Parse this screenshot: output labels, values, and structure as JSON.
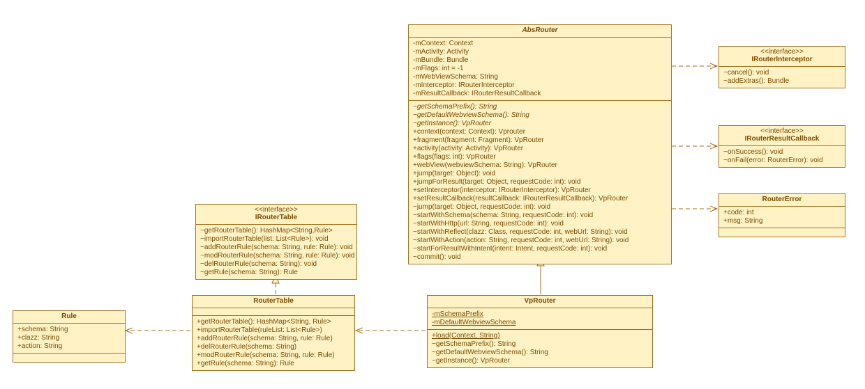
{
  "stereotype_interface": "<<interface>>",
  "rule": {
    "name": "Rule",
    "attrs": [
      "+schema: String",
      "+clazz: String",
      "+action: String"
    ]
  },
  "irouter_table": {
    "name": "IRouterTable",
    "ops": [
      "~getRouterTable(): HashMap<String,Rule>",
      "~importRouterTable(list: List<Rule>): void",
      "~addRouterRule(schema: String, rule: Rule): void",
      "~modRouterRule(schema: String, rule: Rule): void",
      "~delRouterRule(schema: String): void",
      "~getRule(schema: String): Rule"
    ]
  },
  "router_table": {
    "name": "RouterTable",
    "ops": [
      "+getRouterTable(): HashMap<String, Rule>",
      "+importRouterTable(ruleList: List<Rule>)",
      "+addRouterRule(schema: String, rule: Rule)",
      "+delRouterRule(schema: String)",
      "+modRouterRule(schema: String, rule: Rule)",
      "+getRule(schema: String): Rule"
    ]
  },
  "abs_router": {
    "name": "AbsRouter",
    "attrs": [
      "-mContext: Context",
      "-mActivity: Activity",
      "-mBundle: Bundle",
      "-mFlags: int = -1",
      "-mWebViewSchema: String",
      "-mInterceptor: IRouterInterceptor",
      "-mResultCallback: IRouterResultCallback"
    ],
    "ops": [
      "~getSchemaPrefix(): String",
      "~getDefaultWebviewSchema(): String",
      "~getInstance(): VpRouter",
      "+context(context: Context): Vprouter",
      "+fragment(fragment: Fragment): VpRouter",
      "+activity(activity: Activity): VpRouter",
      "+flags(flags: int): VpRouter",
      "+webView(webviewSchema: String): VpRouter",
      "+jump(target: Object): void",
      "+jumpForResult(target: Object, requestCode: int): void",
      "+setInterceptor(interceptor: IRouterInterceptor): VpRouter",
      "+setResultCallback(resultCallback: IRouterResultCallback): VpRouter",
      "~jump(target: Object, requestCode: int): void",
      "~startWithSchema(schema: String, requestCode: int): void",
      "~startWithHttp(url: String, requestCode: int): void",
      "~startWithReflect(clazz: Class, requestCode: int, webUrl: String): void",
      "~startWithAction(action: String, requestCode: int, webUrl: String): void",
      "~startForResultWithIntent(intent: Intent, requestCode: int): void",
      "~commit(): void"
    ]
  },
  "vp_router": {
    "name": "VpRouter",
    "attrs": [
      "-mSchemaPrefix",
      "-mDefaultWebviewSchema"
    ],
    "ops": [
      "+load(Context, String)",
      "~getSchemaPrefix(): String",
      "~getDefaultWebviewSchema(): String",
      "~getInstance(): VpRouter"
    ]
  },
  "irouter_interceptor": {
    "name": "IRouterInterceptor",
    "ops": [
      "~cancel(): void",
      "~addExtras(): Bundle"
    ]
  },
  "irouter_result_callback": {
    "name": "IRouterResultCallback",
    "ops": [
      "~onSuccess(): void",
      "~onFail(error: RouterError): void"
    ]
  },
  "router_error": {
    "name": "RouterError",
    "attrs": [
      "+code: int",
      "+msg: String"
    ]
  },
  "chart_data": {
    "type": "uml_class_diagram",
    "classes": [
      {
        "name": "Rule",
        "attributes": [
          "schema: String",
          "clazz: String",
          "action: String"
        ],
        "operations": []
      },
      {
        "name": "IRouterTable",
        "stereotype": "interface",
        "attributes": [],
        "operations": [
          "getRouterTable(): HashMap<String,Rule>",
          "importRouterTable(list: List<Rule>): void",
          "addRouterRule(schema: String, rule: Rule): void",
          "modRouterRule(schema: String, rule: Rule): void",
          "delRouterRule(schema: String): void",
          "getRule(schema: String): Rule"
        ]
      },
      {
        "name": "RouterTable",
        "attributes": [],
        "operations": [
          "getRouterTable(): HashMap<String,Rule>",
          "importRouterTable(ruleList: List<Rule>)",
          "addRouterRule(schema: String, rule: Rule)",
          "delRouterRule(schema: String)",
          "modRouterRule(schema: String, rule: Rule)",
          "getRule(schema: String): Rule"
        ]
      },
      {
        "name": "AbsRouter",
        "abstract": true,
        "attributes": [
          "mContext: Context",
          "mActivity: Activity",
          "mBundle: Bundle",
          "mFlags: int = -1",
          "mWebViewSchema: String",
          "mInterceptor: IRouterInterceptor",
          "mResultCallback: IRouterResultCallback"
        ],
        "operations": [
          "getSchemaPrefix(): String",
          "getDefaultWebviewSchema(): String",
          "getInstance(): VpRouter",
          "context(context: Context): Vprouter",
          "fragment(fragment: Fragment): VpRouter",
          "activity(activity: Activity): VpRouter",
          "flags(flags: int): VpRouter",
          "webView(webviewSchema: String): VpRouter",
          "jump(target: Object): void",
          "jumpForResult(target: Object, requestCode: int): void",
          "setInterceptor(interceptor: IRouterInterceptor): VpRouter",
          "setResultCallback(resultCallback: IRouterResultCallback): VpRouter",
          "jump(target: Object, requestCode: int): void",
          "startWithSchema(schema: String, requestCode: int): void",
          "startWithHttp(url: String, requestCode: int): void",
          "startWithReflect(clazz: Class, requestCode: int, webUrl: String): void",
          "startWithAction(action: String, requestCode: int, webUrl: String): void",
          "startForResultWithIntent(intent: Intent, requestCode: int): void",
          "commit(): void"
        ]
      },
      {
        "name": "VpRouter",
        "attributes": [
          "mSchemaPrefix",
          "mDefaultWebviewSchema"
        ],
        "operations": [
          "load(Context, String)",
          "getSchemaPrefix(): String",
          "getDefaultWebviewSchema(): String",
          "getInstance(): VpRouter"
        ]
      },
      {
        "name": "IRouterInterceptor",
        "stereotype": "interface",
        "attributes": [],
        "operations": [
          "cancel(): void",
          "addExtras(): Bundle"
        ]
      },
      {
        "name": "IRouterResultCallback",
        "stereotype": "interface",
        "attributes": [],
        "operations": [
          "onSuccess(): void",
          "onFail(error: RouterError): void"
        ]
      },
      {
        "name": "RouterError",
        "attributes": [
          "code: int",
          "msg: String"
        ],
        "operations": []
      }
    ],
    "relationships": [
      {
        "from": "RouterTable",
        "to": "IRouterTable",
        "type": "realization"
      },
      {
        "from": "RouterTable",
        "to": "Rule",
        "type": "dependency"
      },
      {
        "from": "VpRouter",
        "to": "AbsRouter",
        "type": "generalization"
      },
      {
        "from": "VpRouter",
        "to": "RouterTable",
        "type": "dependency"
      },
      {
        "from": "AbsRouter",
        "to": "IRouterInterceptor",
        "type": "dependency"
      },
      {
        "from": "AbsRouter",
        "to": "IRouterResultCallback",
        "type": "dependency"
      },
      {
        "from": "AbsRouter",
        "to": "RouterError",
        "type": "dependency"
      }
    ]
  }
}
